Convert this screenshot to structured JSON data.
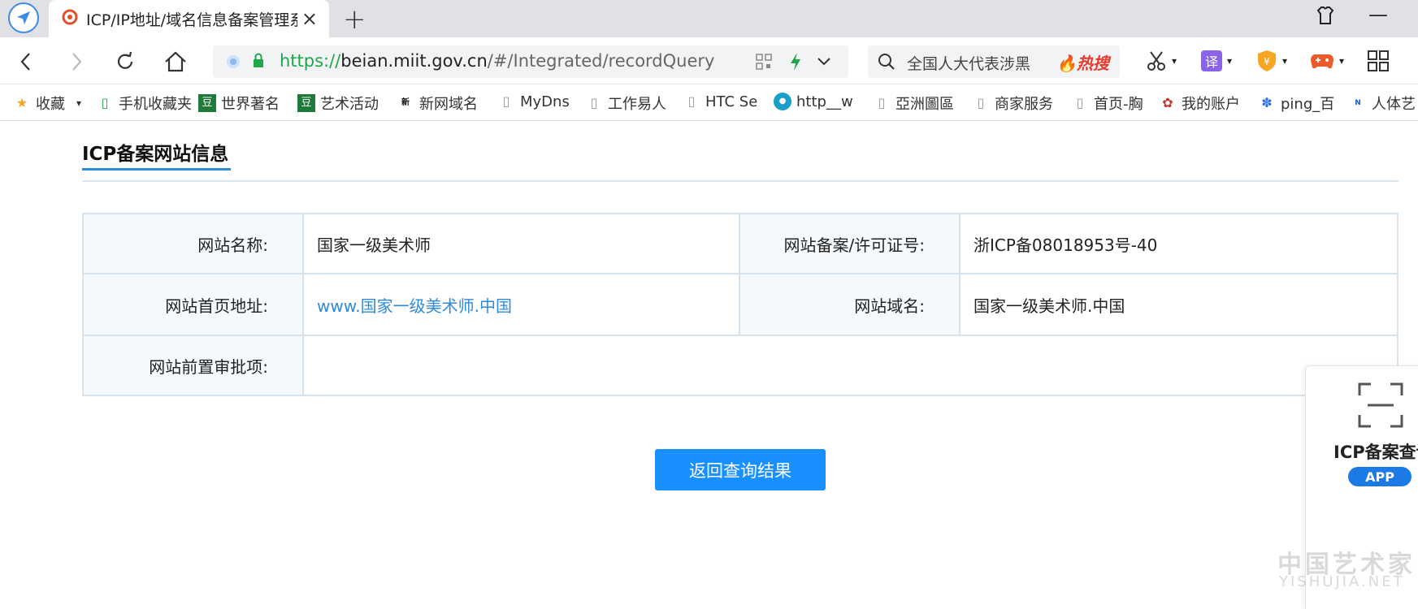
{
  "browser": {
    "tab_title": "ICP/IP地址/域名信息备案管理系",
    "url_scheme": "https://",
    "url_domain": "beian.miit.gov.cn",
    "url_path": "/#/Integrated/recordQuery",
    "search_text": "全国人大代表涉黑",
    "hot_label": "热搜"
  },
  "bookmarks": [
    {
      "label": "收藏",
      "icon": "star-icon"
    },
    {
      "label": "手机收藏夹",
      "icon": "phone-icon"
    },
    {
      "label": "世界著名",
      "icon": "douban-icon"
    },
    {
      "label": "艺术活动",
      "icon": "douban-icon"
    },
    {
      "label": "新网域名",
      "icon": "xinwang-icon"
    },
    {
      "label": "MyDns",
      "icon": "page-icon"
    },
    {
      "label": "工作易人",
      "icon": "page-icon"
    },
    {
      "label": "HTC Se",
      "icon": "page-icon"
    },
    {
      "label": "http__w",
      "icon": "globe-icon"
    },
    {
      "label": "亞洲圖區",
      "icon": "page-icon"
    },
    {
      "label": "商家服务",
      "icon": "page-icon"
    },
    {
      "label": "首页-胸",
      "icon": "page-icon"
    },
    {
      "label": "我的账户",
      "icon": "account-icon"
    },
    {
      "label": "ping_百",
      "icon": "baidu-icon"
    },
    {
      "label": "人体艺",
      "icon": "news-icon"
    }
  ],
  "page": {
    "section_title": "ICP备案网站信息",
    "rows": [
      {
        "label": "网站名称:",
        "value": "国家一级美术师",
        "label2": "网站备案/许可证号:",
        "value2": "浙ICP备08018953号-40"
      },
      {
        "label": "网站首页地址:",
        "value": "www.国家一级美术师.中国",
        "label2": "网站域名:",
        "value2": "国家一级美术师.中国"
      },
      {
        "label": "网站前置审批项:",
        "value": ""
      }
    ],
    "back_button": "返回查询结果"
  },
  "side_panel": {
    "title": "ICP备案查询",
    "badge": "APP"
  },
  "watermark": {
    "line1": "中国艺术家",
    "line2": "YISHUJIA.NET"
  },
  "colors": {
    "accent": "#1890ff",
    "link": "#2e8ad8",
    "https_green": "#1fa64a"
  }
}
